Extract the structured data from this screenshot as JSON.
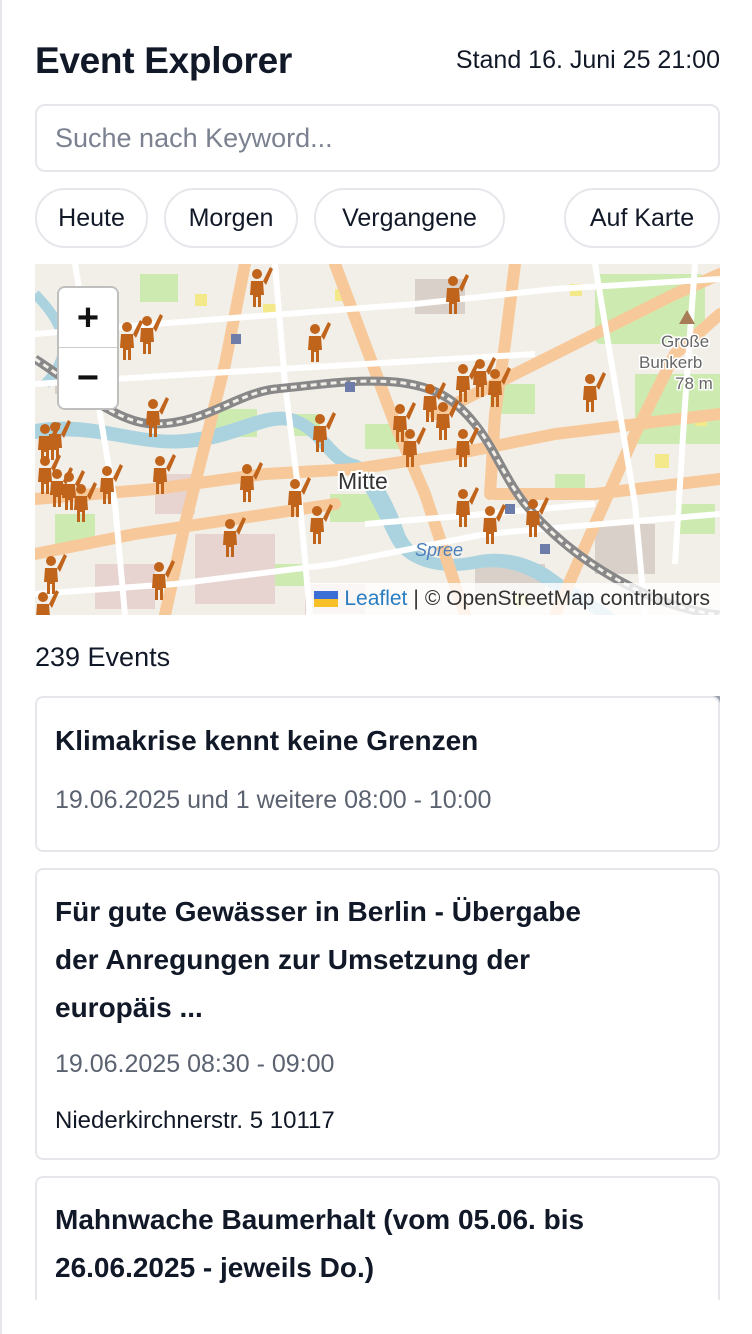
{
  "header": {
    "title": "Event Explorer",
    "stand": "Stand 16. Juni 25 21:00"
  },
  "search": {
    "placeholder": "Suche nach Keyword...",
    "value": ""
  },
  "filters": {
    "today": "Heute",
    "tomorrow": "Morgen",
    "past": "Vergangene",
    "on_map": "Auf Karte"
  },
  "map": {
    "zoom_in": "+",
    "zoom_out": "−",
    "labels": {
      "district": "Mitte",
      "river": "Spree",
      "poi_line1": "Große",
      "poi_line2": "Bunkerb",
      "poi_elev": "78 m"
    },
    "attribution": {
      "leaflet": "Leaflet",
      "separator": "|",
      "osm": "© OpenStreetMap contributors"
    },
    "marker_icon": "person-waving-icon",
    "marker_color": "#c0631b",
    "flag_colors": [
      "#3b6fd6",
      "#f6c026"
    ]
  },
  "results": {
    "count": "239 Events"
  },
  "events": [
    {
      "title": "Klimakrise kennt keine Grenzen",
      "time": "19.06.2025 und 1 weitere 08:00 - 10:00",
      "location": ""
    },
    {
      "title_lines": [
        "Für gute Gewässer in Berlin - Übergabe",
        "der Anregungen zur Umsetzung der",
        "europäis ..."
      ],
      "time": "19.06.2025 08:30 - 09:00",
      "location": "Niederkirchnerstr. 5 10117"
    },
    {
      "title_lines": [
        "Mahnwache Baumerhalt (vom 05.06. bis",
        "26.06.2025 - jeweils Do.)"
      ],
      "time": "",
      "location": ""
    }
  ]
}
